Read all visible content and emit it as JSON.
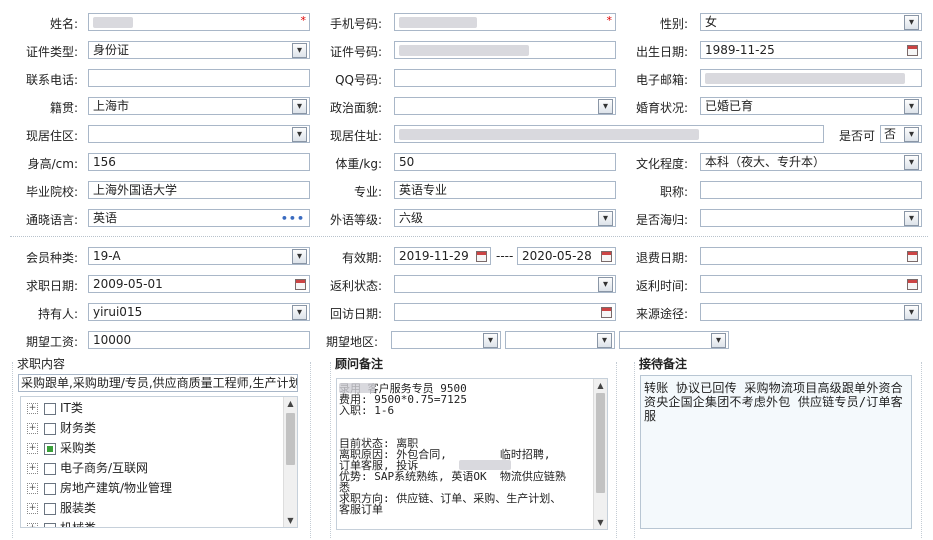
{
  "personal": {
    "name_label": "姓名:",
    "name_req": "*",
    "mobile_label": "手机号码:",
    "mobile_req": "*",
    "gender_label": "性别:",
    "gender_value": "女",
    "idtype_label": "证件类型:",
    "idtype_value": "身份证",
    "idno_label": "证件号码:",
    "birth_label": "出生日期:",
    "birth_value": "1989-11-25",
    "phone_label": "联系电话:",
    "qq_label": "QQ号码:",
    "email_label": "电子邮箱:",
    "native_label": "籍贯:",
    "native_value": "上海市",
    "political_label": "政治面貌:",
    "marital_label": "婚育状况:",
    "marital_value": "已婚已育",
    "district_label": "现居住区:",
    "address_label": "现居住址:",
    "isornot_label": "是否可",
    "isornot_value": "否",
    "height_label": "身高/cm:",
    "height_value": "156",
    "weight_label": "体重/kg:",
    "weight_value": "50",
    "education_label": "文化程度:",
    "education_value": "本科（夜大、专升本）",
    "school_label": "毕业院校:",
    "school_value": "上海外国语大学",
    "major_label": "专业:",
    "major_value": "英语专业",
    "title_label": "职称:",
    "language_label": "通晓语言:",
    "language_value": "英语",
    "language_more": "•••",
    "flevel_label": "外语等级:",
    "flevel_value": "六级",
    "overseas_label": "是否海归:"
  },
  "membership": {
    "type_label": "会员种类:",
    "type_value": "19-A",
    "valid_label": "有效期:",
    "valid_from": "2019-11-29",
    "valid_dash": "----",
    "valid_to": "2020-05-28",
    "refund_label": "退费日期:",
    "jobdate_label": "求职日期:",
    "jobdate_value": "2009-05-01",
    "rebate_status_label": "返利状态:",
    "rebate_time_label": "返利时间:",
    "holder_label": "持有人:",
    "holder_value": "yirui015",
    "visit_label": "回访日期:",
    "source_label": "来源途径:",
    "salary_label": "期望工资:",
    "salary_value": "10000",
    "region_label": "期望地区:"
  },
  "job_panel": {
    "title": "求职内容",
    "selected_text": "采购跟单,采购助理/专员,供应商质量工程师,生产计划",
    "tree": [
      {
        "label": "IT类",
        "state": "none"
      },
      {
        "label": "财务类",
        "state": "none"
      },
      {
        "label": "采购类",
        "state": "partial"
      },
      {
        "label": "电子商务/互联网",
        "state": "none"
      },
      {
        "label": "房地产建筑/物业管理",
        "state": "none"
      },
      {
        "label": "服装类",
        "state": "none"
      },
      {
        "label": "机械类",
        "state": "none"
      }
    ]
  },
  "advisor_panel": {
    "title": "顾问备注",
    "lines": [
      "录用 客户服务专员 9500",
      "费用: 9500*0.75=7125",
      "入职: 1-6",
      "",
      "",
      "目前状态: 离职",
      "离职原因: 外包合同,        临时招聘,",
      "订单客服, 投诉",
      "优势: SAP系统熟练, 英语OK  物流供应链熟",
      "悉",
      "求职方向: 供应链、订单、采购、生产计划、",
      "客服订单"
    ]
  },
  "reception_panel": {
    "title": "接待备注",
    "text": "转账 协议已回传 采购物流项目高级跟单外资合资央企国企集团不考虑外包  供应链专员/订单客服"
  },
  "colors": {
    "accent": "#3a6bc0",
    "required": "#dd0000",
    "border": "#a9b7c8"
  }
}
